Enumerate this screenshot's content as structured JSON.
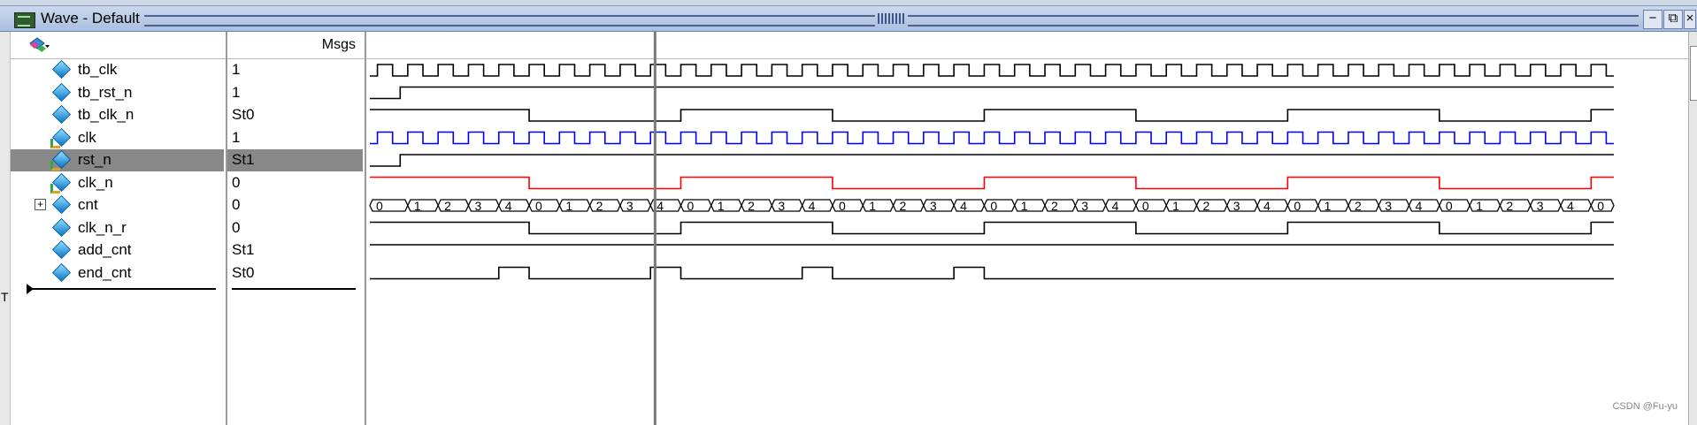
{
  "window": {
    "title": "Wave - Default"
  },
  "columns": {
    "msgs_label": "Msgs"
  },
  "signals": [
    {
      "name": "tb_clk",
      "value": "1",
      "kind": "in",
      "selected": false
    },
    {
      "name": "tb_rst_n",
      "value": "1",
      "kind": "in",
      "selected": false
    },
    {
      "name": "tb_clk_n",
      "value": "St0",
      "kind": "in",
      "selected": false
    },
    {
      "name": "clk",
      "value": "1",
      "kind": "inout",
      "selected": false
    },
    {
      "name": "rst_n",
      "value": "St1",
      "kind": "inout",
      "selected": true
    },
    {
      "name": "clk_n",
      "value": "0",
      "kind": "inout",
      "selected": false
    },
    {
      "name": "cnt",
      "value": "0",
      "kind": "bus",
      "selected": false
    },
    {
      "name": "clk_n_r",
      "value": "0",
      "kind": "in",
      "selected": false
    },
    {
      "name": "add_cnt",
      "value": "St1",
      "kind": "in",
      "selected": false
    },
    {
      "name": "end_cnt",
      "value": "St0",
      "kind": "in",
      "selected": false
    }
  ],
  "waveform": {
    "cursor_cycle": 9.4,
    "clock_cycles": 41,
    "trace_colors": {
      "default": "#000000",
      "clk": "#0000ff",
      "clk_n": "#ff0000",
      "cursor": "#7a7a7a"
    },
    "cnt_values": [
      "0",
      "1",
      "2",
      "3",
      "4",
      "0",
      "1",
      "2",
      "3",
      "4",
      "0",
      "1",
      "2",
      "3",
      "4",
      "0",
      "1",
      "2",
      "3",
      "4",
      "0"
    ]
  },
  "watermark": "CSDN @Fu-yu",
  "side_letter": "T"
}
